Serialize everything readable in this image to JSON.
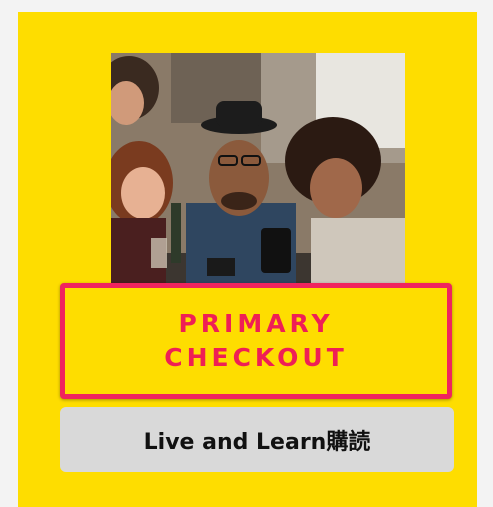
{
  "promo": {
    "background_color": "#fedd00",
    "image_subject": "group-of-friends-looking-at-phone-photo",
    "primary_button": {
      "line1": "PRIMARY",
      "line2": "CHECKOUT",
      "border_color": "#f0245e",
      "text_color": "#ef1f55"
    },
    "secondary_button": {
      "label": "Live and Learn購読",
      "background_color": "#d9d9d9"
    }
  }
}
